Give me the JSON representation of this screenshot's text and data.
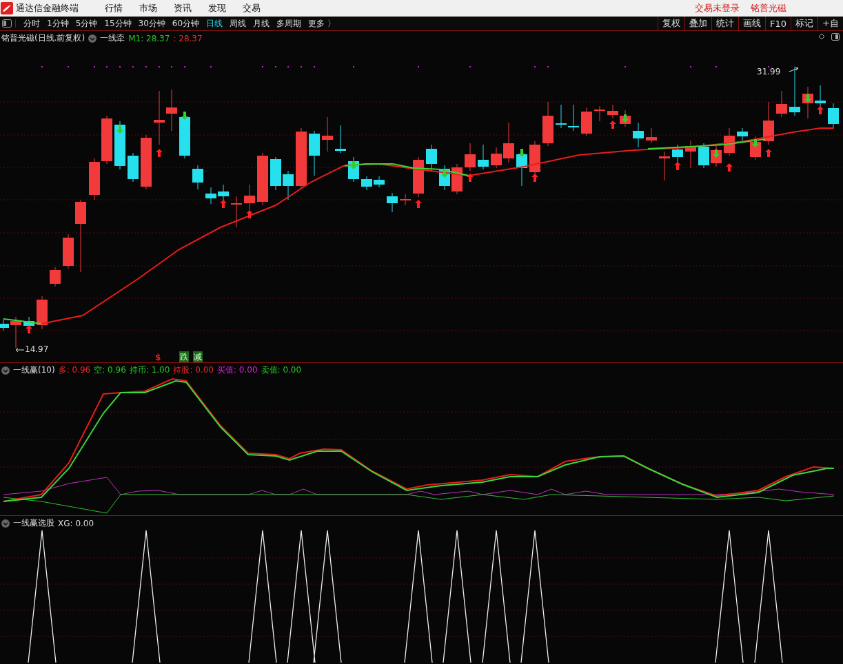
{
  "app_bar": {
    "title": "通达信金融终端",
    "menu": [
      "行情",
      "市场",
      "资讯",
      "发现",
      "交易"
    ],
    "trade_status": "交易未登录",
    "stock_name": "铭普光磁"
  },
  "period_bar": {
    "periods": [
      {
        "label": "分时",
        "selected": false
      },
      {
        "label": "1分钟",
        "selected": false
      },
      {
        "label": "5分钟",
        "selected": false
      },
      {
        "label": "15分钟",
        "selected": false
      },
      {
        "label": "30分钟",
        "selected": false
      },
      {
        "label": "60分钟",
        "selected": false
      },
      {
        "label": "日线",
        "selected": true
      },
      {
        "label": "周线",
        "selected": false
      },
      {
        "label": "月线",
        "selected": false
      },
      {
        "label": "多周期",
        "selected": false
      }
    ],
    "more": "更多 〉",
    "tools": [
      "复权",
      "叠加",
      "统计",
      "画线",
      "F10",
      "标记",
      "+自"
    ]
  },
  "main_chart": {
    "title": "铭普光磁(日线.前复权)",
    "indicator": "一线牵",
    "readouts": [
      {
        "text": "M1: 28.37",
        "color": "#22cc22"
      },
      {
        "text": ": 28.37",
        "color": "#ee2a2a"
      }
    ],
    "high_label": "31.99",
    "low_label": "14.97",
    "signals": [
      {
        "text": "$",
        "kind": "mark"
      },
      {
        "text": "跌",
        "kind": "tag"
      },
      {
        "text": "减",
        "kind": "tag"
      }
    ]
  },
  "indicator_panel": {
    "title": "一线赢(10)",
    "readouts": [
      {
        "text": "多: 0.96",
        "color": "#ee2a2a"
      },
      {
        "text": "空: 0.96",
        "color": "#22cc22"
      },
      {
        "text": "持币: 1.00",
        "color": "#22cc22"
      },
      {
        "text": "持股: 0.00",
        "color": "#ee2a2a"
      },
      {
        "text": "买值: 0.00",
        "color": "#dd22dd"
      },
      {
        "text": "卖值: 0.00",
        "color": "#22cc22"
      }
    ]
  },
  "screener_panel": {
    "title": "一线赢选股",
    "readouts": [
      {
        "text": "XG: 0.00",
        "color": "#dddddd"
      }
    ]
  }
}
